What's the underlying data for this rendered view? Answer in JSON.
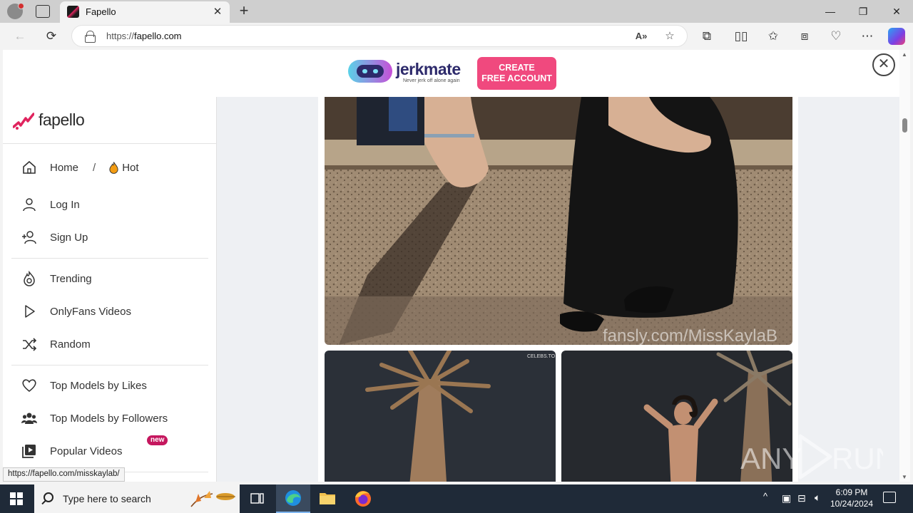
{
  "browser": {
    "tab_title": "Fapello",
    "tab_close": "✕",
    "new_tab": "+",
    "url_scheme": "https://",
    "url_host": "fapello.com",
    "window_minimize": "—",
    "window_restore": "❐",
    "window_close": "✕",
    "status_bar_url": "https://fapello.com/misskaylab/"
  },
  "ad": {
    "brand": "jerkmate",
    "tagline": "Never jerk off alone again",
    "cta_line1": "CREATE",
    "cta_line2": "FREE ACCOUNT",
    "close_symbol": "✕"
  },
  "site": {
    "brand": "fapello",
    "brand_color": "#e0245e",
    "nav": {
      "home": "Home",
      "separator": "/",
      "hot": "Hot",
      "login": "Log In",
      "signup": "Sign Up",
      "trending": "Trending",
      "onlyfans_videos": "OnlyFans Videos",
      "random": "Random",
      "top_likes": "Top Models by Likes",
      "top_followers": "Top Models by Followers",
      "popular_videos": "Popular Videos",
      "new_badge": "new"
    },
    "hero_watermark": "fansly.com/MissKaylaB",
    "thumb_watermark": "CELEBS.TO"
  },
  "taskbar": {
    "search_placeholder": "Type here to search",
    "time": "6:09 PM",
    "date": "10/24/2024"
  },
  "overlay": {
    "watermark_left": "ANY",
    "watermark_right": "RUN"
  }
}
